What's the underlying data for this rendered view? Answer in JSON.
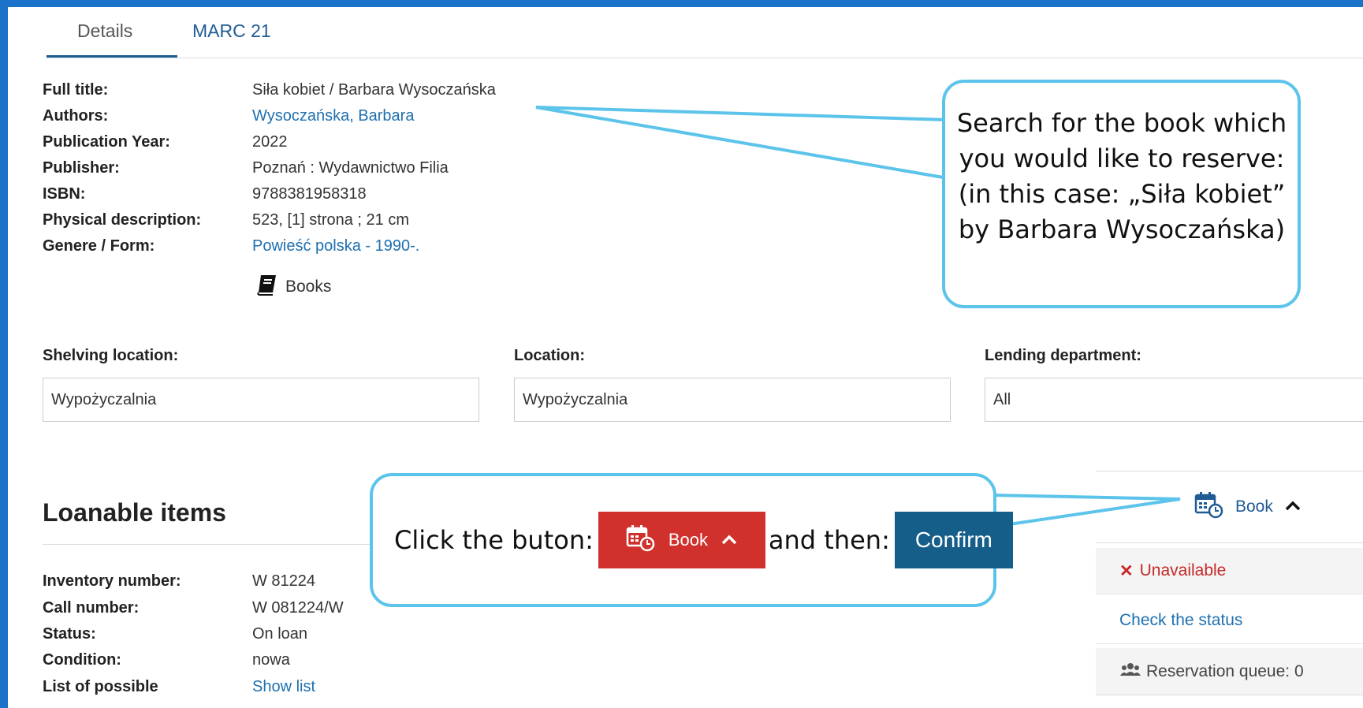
{
  "tabs": [
    {
      "label": "Details"
    },
    {
      "label": "MARC 21"
    }
  ],
  "details": {
    "full_title": {
      "label": "Full title:",
      "value": "Siła kobiet / Barbara Wysoczańska"
    },
    "authors": {
      "label": "Authors:",
      "value": "Wysoczańska, Barbara"
    },
    "year": {
      "label": "Publication Year:",
      "value": "2022"
    },
    "publisher": {
      "label": "Publisher:",
      "value": "Poznań : Wydawnictwo Filia"
    },
    "isbn": {
      "label": "ISBN:",
      "value": "9788381958318"
    },
    "physical": {
      "label": "Physical description:",
      "value": "523, [1] strona ; 21 cm"
    },
    "genre": {
      "label": "Genere / Form:",
      "value": "Powieść polska - 1990-."
    },
    "type_label": "Books"
  },
  "filters": {
    "shelving": {
      "label": "Shelving location:",
      "value": "Wypożyczalnia"
    },
    "location": {
      "label": "Location:",
      "value": "Wypożyczalnia"
    },
    "lending": {
      "label": "Lending department:",
      "value": "All"
    }
  },
  "loanable": {
    "title": "Loanable items",
    "inventory": {
      "label": "Inventory number:",
      "value": "W 81224"
    },
    "call_number": {
      "label": "Call number:",
      "value": "W 081224/W"
    },
    "status": {
      "label": "Status:",
      "value": "On loan"
    },
    "condition": {
      "label": "Condition:",
      "value": "nowa"
    },
    "possible": {
      "label": "List of possible",
      "value": "Show list"
    }
  },
  "side_panel": {
    "book_label": "Book",
    "unavailable": "Unavailable",
    "check_status": "Check the status",
    "queue": "Reservation queue: 0"
  },
  "callouts": {
    "search_text": "Search for the book which you would like to reserve: (in this case: „Siła kobiet” by Barbara Wysoczańska)",
    "click_text": "Click the buton:",
    "then_text": "and then:",
    "book_button": "Book",
    "confirm_button": "Confirm",
    "accent_color": "#5cc4ea"
  },
  "colors": {
    "frame": "#1a73c8",
    "red": "#d0312d",
    "confirm": "#155e8a",
    "link": "#1f70b0"
  }
}
